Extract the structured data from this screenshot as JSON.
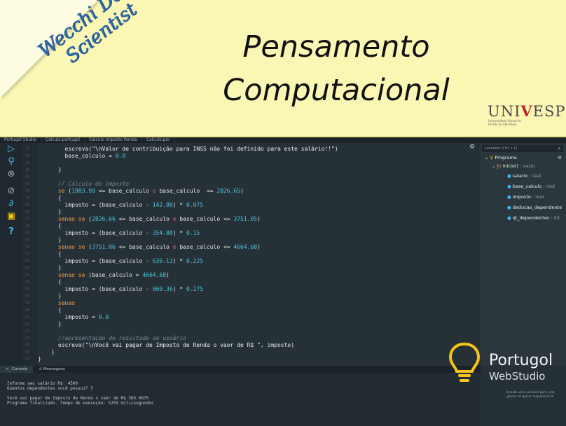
{
  "banner": {
    "brand_line1": "Wecchi Data",
    "brand_line2": "Scientist",
    "title_line1": "Pensamento",
    "title_line2": "Computacional",
    "univ_prefix": "UNI",
    "univ_v": "V",
    "univ_suffix": "ESP",
    "univ_sub": "Universidade Virtual do Estado de São Paulo"
  },
  "tabs": [
    "Portugol Studio",
    "Calculo.portugol",
    "Calculo Imposto Renda",
    "Calculo.por"
  ],
  "code_lines": [
    {
      "gutter": "37",
      "html": "        escreva(<span class='str'>\"\\nValor de contribuição para INSS não foi definido para este salário!!\"</span>)"
    },
    {
      "gutter": "38",
      "html": "        base_calculo = <span class='num'>0.0</span>"
    },
    {
      "gutter": "39",
      "html": ""
    },
    {
      "gutter": "40",
      "html": "      }"
    },
    {
      "gutter": "41",
      "html": ""
    },
    {
      "gutter": "42",
      "html": "      <span class='cm'>// Cálculo do imposto</span>"
    },
    {
      "gutter": "43",
      "html": "      <span class='kw'>se</span> (<span class='num'>1903.99</span> &lt;= base_calculo <span class='op'>e</span> base_calculo  &lt;= <span class='num'>2826.65</span>)"
    },
    {
      "gutter": "44",
      "html": "      {"
    },
    {
      "gutter": "45",
      "html": "        imposto = (base_calculo - <span class='num'>142.80</span>) * <span class='num'>0.075</span>"
    },
    {
      "gutter": "46",
      "html": "      }"
    },
    {
      "gutter": "47",
      "html": "      <span class='kw'>senao se</span> (<span class='num'>2826.66</span> &lt;= base_calculo <span class='op'>e</span> base_calculo &lt;= <span class='num'>3751.05</span>)"
    },
    {
      "gutter": "48",
      "html": "      {"
    },
    {
      "gutter": "49",
      "html": "        imposto = (base_calculo - <span class='num'>354.80</span>) * <span class='num'>0.15</span>"
    },
    {
      "gutter": "50",
      "html": "      }"
    },
    {
      "gutter": "51",
      "html": "      <span class='kw'>senao se</span> (<span class='num'>3751.06</span> &lt;= base_calculo <span class='op'>e</span> base_calculo &lt;= <span class='num'>4664.68</span>)"
    },
    {
      "gutter": "52",
      "html": "      {"
    },
    {
      "gutter": "53",
      "html": "        imposto = (base_calculo - <span class='num'>636.13</span>) * <span class='num'>0.225</span>"
    },
    {
      "gutter": "54",
      "html": "      }"
    },
    {
      "gutter": "55",
      "html": "      <span class='kw'>senao se</span> (base_calculo &gt; <span class='num'>4664.68</span>)"
    },
    {
      "gutter": "56",
      "html": "      {"
    },
    {
      "gutter": "57",
      "html": "        imposto = (base_calculo - <span class='num'>869.36</span>) * <span class='num'>0.275</span>"
    },
    {
      "gutter": "58",
      "html": "      }"
    },
    {
      "gutter": "59",
      "html": "      <span class='kw'>senao</span>"
    },
    {
      "gutter": "60",
      "html": "      {"
    },
    {
      "gutter": "61",
      "html": "        imposto = <span class='num'>0.0</span>"
    },
    {
      "gutter": "62",
      "html": "      }"
    },
    {
      "gutter": "63",
      "html": ""
    },
    {
      "gutter": "64",
      "html": "      <span class='cm'>//apresentação do resultado ao usuário</span>"
    },
    {
      "gutter": "65",
      "html": "      escreva(<span class='str'>\"\\nVocê vai pagar de Imposto de Renda o vaor de R$ \"</span>, imposto)"
    },
    {
      "gutter": "66",
      "html": "    }"
    },
    {
      "gutter": "67",
      "html": "}"
    }
  ],
  "tree": {
    "search_placeholder": "Localizar (Ctrl + L)",
    "root": "Programa",
    "func": "inicio()",
    "func_type": ": vazio",
    "vars": [
      {
        "name": "salario",
        "type": ": real"
      },
      {
        "name": "base_calculo",
        "type": ": real"
      },
      {
        "name": "imposto",
        "type": ": real"
      },
      {
        "name": "deducao_dependente",
        "type": ""
      },
      {
        "name": "qt_dependentes",
        "type": ": int"
      }
    ]
  },
  "console": {
    "tab_console": "Console",
    "tab_messages": "Mensagens",
    "output": "Informe seu salário R$: 4500\nQuantos dependentes você possui? 5\n\nVocê vai pagar de Imposto de Renda o vaor de R$ 385.0875\nPrograma finalizado. Tempo de execução: 5255 milissegundos"
  },
  "logo": {
    "name": "Portugol",
    "sub": "WebStudio",
    "hint": "Arraste uma variável para este painel se quiser inspecioná-la"
  },
  "colors": {
    "accent": "#4ab8e8",
    "bulb": "#f6c416",
    "keyword": "#f4a14e",
    "number": "#4ec9e0"
  }
}
